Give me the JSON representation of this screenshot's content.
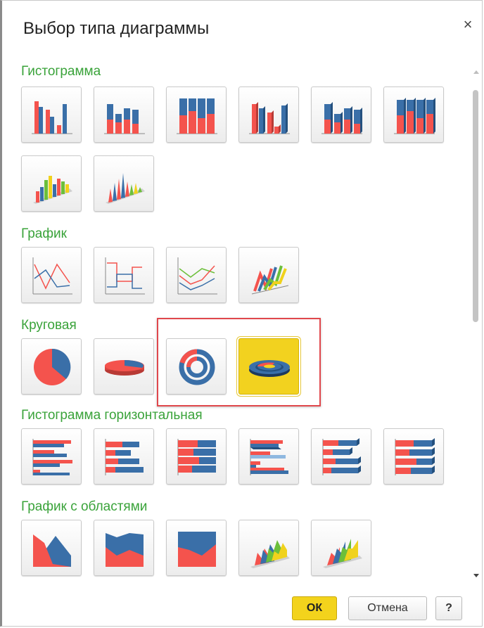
{
  "dialog": {
    "title": "Выбор типа диаграммы",
    "close_symbol": "×"
  },
  "sections": [
    {
      "title": "Гистограмма",
      "charts": [
        "column-grouped",
        "column-stacked",
        "column-stacked-100",
        "column-3d",
        "column-3d-stacked",
        "column-3d-stacked-100",
        "column-3d-perspective",
        "column-3d-cone"
      ]
    },
    {
      "title": "График",
      "charts": [
        "line",
        "line-step",
        "line-smooth",
        "line-3d"
      ]
    },
    {
      "title": "Круговая",
      "charts": [
        "pie",
        "pie-3d",
        "ring",
        "ring-3d"
      ],
      "selected": "ring-3d"
    },
    {
      "title": "Гистограмма горизонтальная",
      "charts": [
        "bar-grouped",
        "bar-stacked",
        "bar-stacked-100",
        "bar-3d",
        "bar-3d-stacked",
        "bar-3d-stacked-100"
      ]
    },
    {
      "title": "График с областями",
      "charts": [
        "area",
        "area-stacked",
        "area-stacked-100",
        "area-3d",
        "area-3d-stacked"
      ]
    }
  ],
  "colors": {
    "red": "#f4534d",
    "blue": "#3a6fa8",
    "green": "#6cbf3a",
    "yellow": "#f0d21c",
    "section_title": "#3aa33a",
    "highlight": "#e0474c"
  },
  "buttons": {
    "ok": "ОК",
    "cancel": "Отмена",
    "help": "?"
  }
}
